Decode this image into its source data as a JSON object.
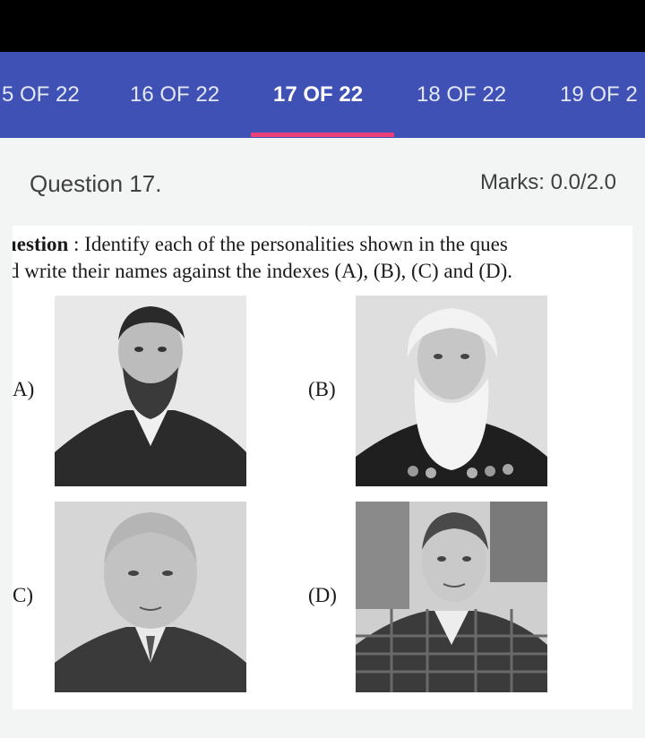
{
  "tabs": [
    {
      "label": "5 OF 22",
      "active": false
    },
    {
      "label": "16 OF 22",
      "active": false
    },
    {
      "label": "17 OF 22",
      "active": true
    },
    {
      "label": "18 OF 22",
      "active": false
    },
    {
      "label": "19 OF 2",
      "active": false
    }
  ],
  "colors": {
    "tab_bar": "#3f51b5",
    "indicator": "#ec407a",
    "background": "#f3f4f4"
  },
  "question": {
    "title": "Question 17.",
    "marks": "Marks: 0.0/2.0",
    "label": "uestion",
    "separator": " : ",
    "line1_text": "Identify each of the personalities shown in the ques",
    "line2_text": "d write their names against the indexes (A), (B), (C) and (D)."
  },
  "options": [
    {
      "label": "A)",
      "photo": "portrait-bearded-man"
    },
    {
      "label": "(B)",
      "photo": "portrait-white-bearded-man"
    },
    {
      "label": "C)",
      "photo": "portrait-bald-man"
    },
    {
      "label": "(D)",
      "photo": "portrait-man-plaid-jacket"
    }
  ]
}
